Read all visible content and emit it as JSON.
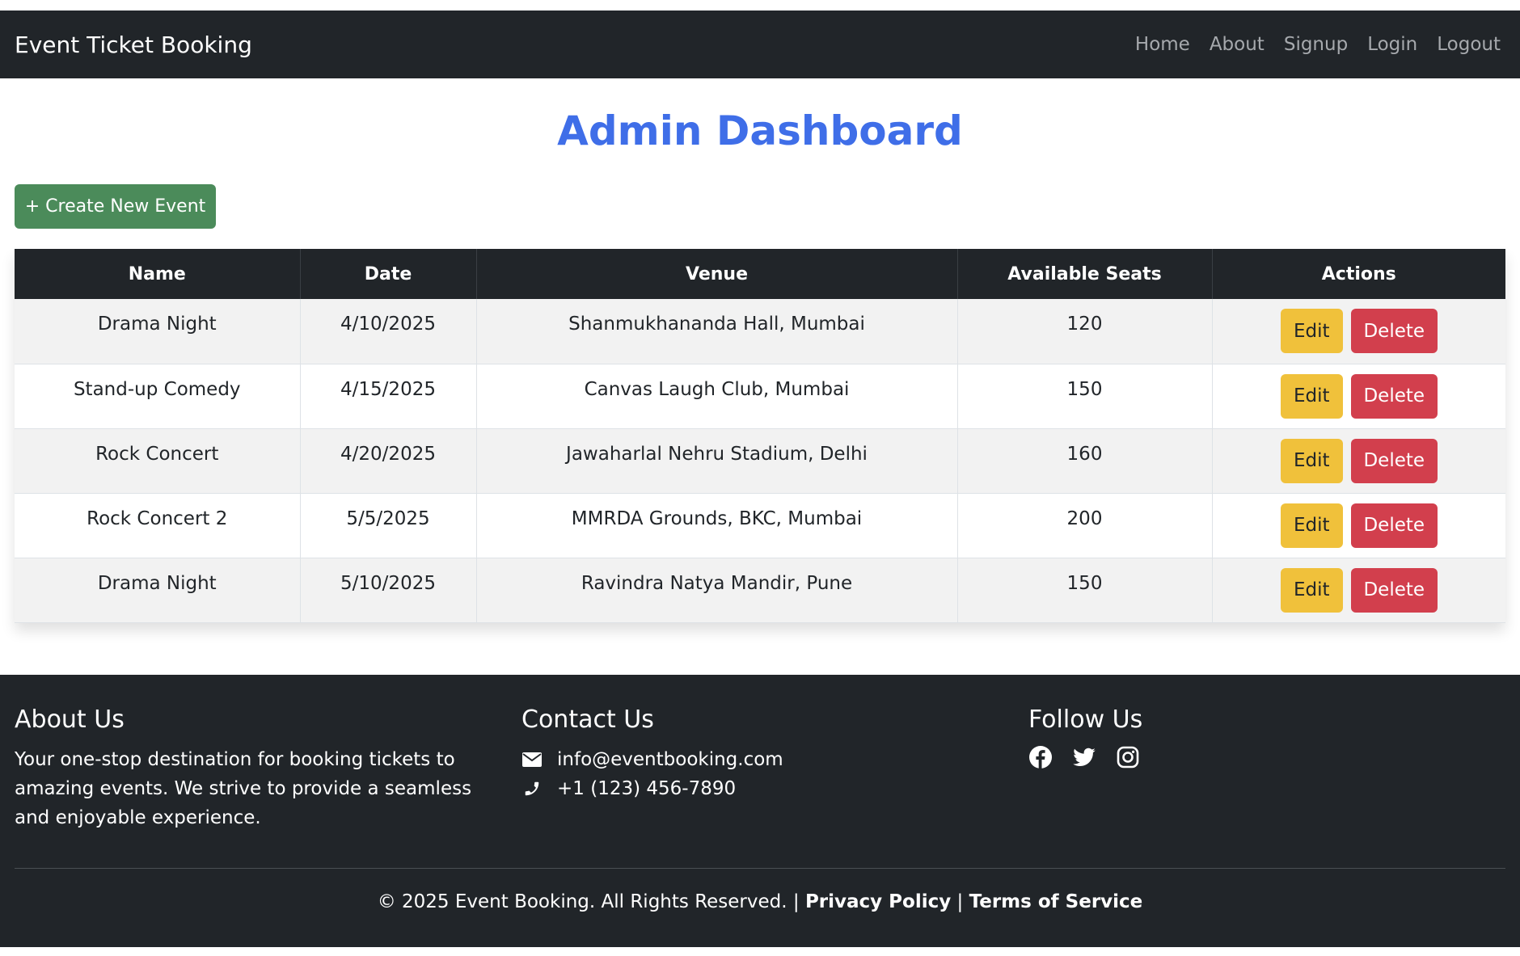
{
  "navbar": {
    "brand": "Event Ticket Booking",
    "links": [
      "Home",
      "About",
      "Signup",
      "Login",
      "Logout"
    ]
  },
  "page": {
    "title": "Admin Dashboard",
    "create_button": "+ Create New Event"
  },
  "table": {
    "headers": [
      "Name",
      "Date",
      "Venue",
      "Available Seats",
      "Actions"
    ],
    "rows": [
      {
        "name": "Drama Night",
        "date": "4/10/2025",
        "venue": "Shanmukhananda Hall, Mumbai",
        "seats": "120"
      },
      {
        "name": "Stand-up Comedy",
        "date": "4/15/2025",
        "venue": "Canvas Laugh Club, Mumbai",
        "seats": "150"
      },
      {
        "name": "Rock Concert",
        "date": "4/20/2025",
        "venue": "Jawaharlal Nehru Stadium, Delhi",
        "seats": "160"
      },
      {
        "name": "Rock Concert 2",
        "date": "5/5/2025",
        "venue": "MMRDA Grounds, BKC, Mumbai",
        "seats": "200"
      },
      {
        "name": "Drama Night",
        "date": "5/10/2025",
        "venue": "Ravindra Natya Mandir, Pune",
        "seats": "150"
      }
    ],
    "edit_label": "Edit",
    "delete_label": "Delete"
  },
  "footer": {
    "about": {
      "title": "About Us",
      "text": "Your one-stop destination for booking tickets to amazing events. We strive to provide a seamless and enjoyable experience."
    },
    "contact": {
      "title": "Contact Us",
      "email": "info@eventbooking.com",
      "phone": "+1 (123) 456-7890",
      "icons": [
        "envelope-icon",
        "phone-icon"
      ]
    },
    "follow": {
      "title": "Follow Us",
      "icons": [
        "facebook-icon",
        "twitter-icon",
        "instagram-icon"
      ]
    },
    "copyright": "© 2025 Event Booking. All Rights Reserved. |",
    "privacy": "Privacy Policy",
    "separator": "|",
    "terms": "Terms of Service"
  },
  "colors": {
    "navbar_bg": "#212529",
    "title": "#3f6ee8",
    "create_button": "#4b8b5a",
    "edit_button": "#f0c13b",
    "delete_button": "#d23f4d"
  }
}
